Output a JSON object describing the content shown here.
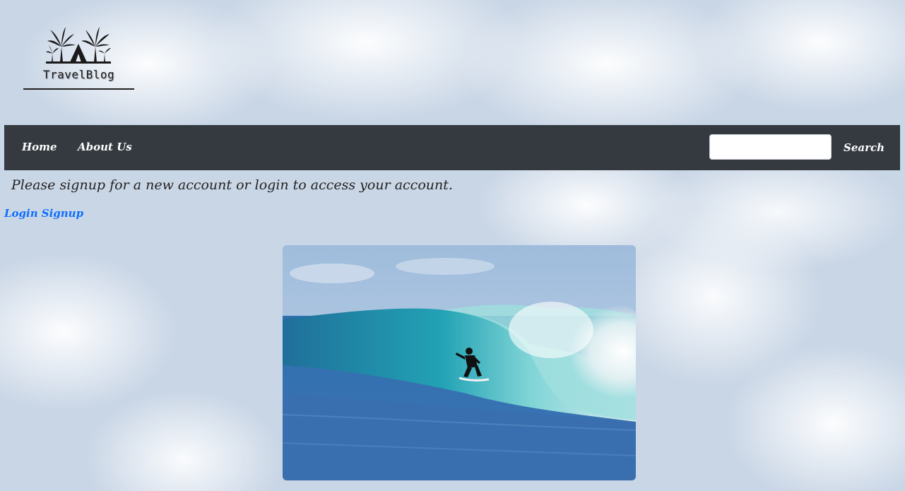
{
  "brand": {
    "name": "TravelBlog",
    "logo_icon": "palm-tent-icon"
  },
  "nav": {
    "items": [
      {
        "label": "Home"
      },
      {
        "label": "About Us"
      }
    ],
    "search": {
      "value": "",
      "placeholder": "",
      "button_label": "Search"
    }
  },
  "main": {
    "message": "Please signup for a new account or login to access your account.",
    "links": {
      "login": "Login",
      "signup": "Signup"
    },
    "hero_image": "surfer-in-wave-barrel-photo"
  },
  "colors": {
    "navbar": "#343a40",
    "link": "#0d6efd",
    "text": "#222222"
  }
}
